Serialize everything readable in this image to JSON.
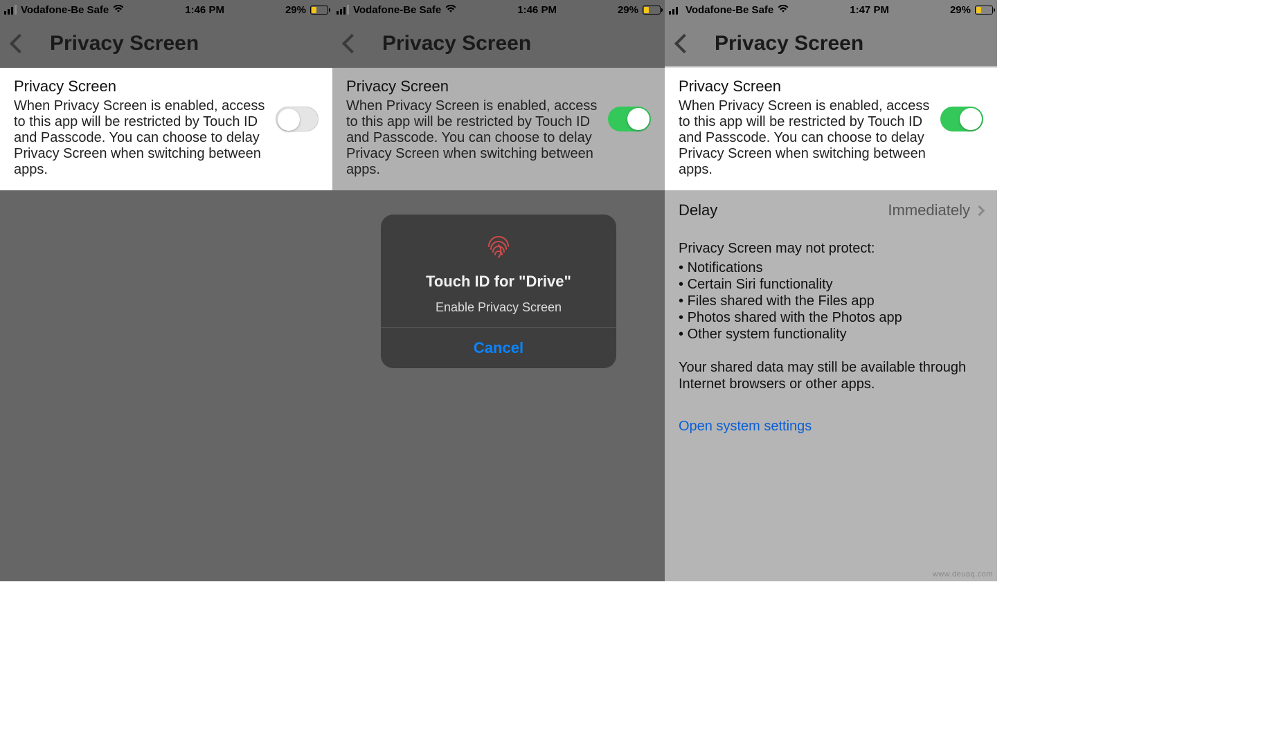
{
  "statusbar": {
    "carrier": "Vodafone-Be Safe",
    "time1": "1:46 PM",
    "time2": "1:46 PM",
    "time3": "1:47 PM",
    "battery_pct": "29%"
  },
  "nav": {
    "title": "Privacy Screen"
  },
  "privacy_card": {
    "title": "Privacy Screen",
    "desc": "When Privacy Screen is enabled, access to this app will be restricted by Touch ID and Passcode. You can choose to delay Privacy Screen when switching between apps."
  },
  "modal": {
    "title": "Touch ID for \"Drive\"",
    "subtitle": "Enable Privacy Screen",
    "cancel": "Cancel"
  },
  "delay": {
    "label": "Delay",
    "value": "Immediately"
  },
  "notes": {
    "heading": "Privacy Screen may not protect:",
    "bullets": [
      "Notifications",
      "Certain Siri functionality",
      "Files shared with the Files app",
      "Photos shared with the Photos app",
      "Other system functionality"
    ],
    "disclaimer": "Your shared data may still be available through Internet browsers or other apps.",
    "link": "Open system settings"
  },
  "watermark": "www.deuaq.com"
}
